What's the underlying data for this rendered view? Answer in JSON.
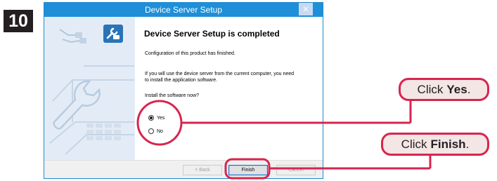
{
  "step": {
    "number": "10"
  },
  "dialog": {
    "title": "Device Server Setup",
    "close_glyph": "✕",
    "heading": "Device Server Setup is completed",
    "configured_text": "Configuration of this product has finished.",
    "info_line1": "If you will use the device server from the current computer, you need",
    "info_line2": "to install the application software.",
    "prompt": "Install the software now?",
    "options": [
      {
        "label": "Yes",
        "selected": true
      },
      {
        "label": "No",
        "selected": false
      }
    ],
    "buttons": {
      "back": "< Back",
      "finish": "Finish",
      "cancel": "Cancel"
    },
    "icons": [
      "setup-icon",
      "cable-icon",
      "wrench-laptop-illustration"
    ]
  },
  "callouts": {
    "yes": {
      "prefix": "Click",
      "emphasis": "Yes",
      "suffix": "."
    },
    "finish": {
      "prefix": "Click",
      "emphasis": "Finish",
      "suffix": "."
    }
  },
  "colors": {
    "accent": "#d7254f",
    "titlebar": "#1e8fd8",
    "callout_fill": "#f3e6e5"
  }
}
